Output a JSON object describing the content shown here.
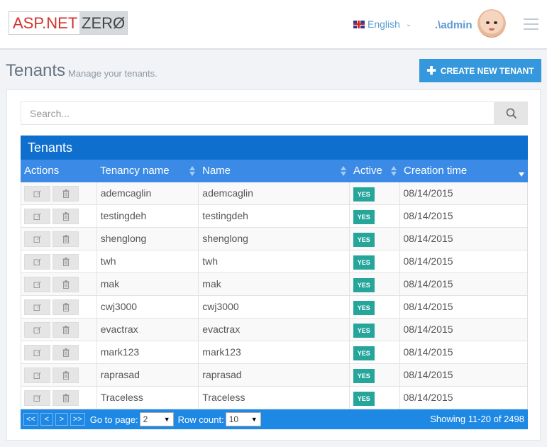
{
  "header": {
    "logo_left": "ASP.NET",
    "logo_right": "ZERØ",
    "language": "English",
    "username": ".\\admin",
    "language_icon": "uk-flag-icon",
    "menu_icon": "hamburger-icon"
  },
  "page": {
    "title": "Tenants",
    "subtitle": "Manage your tenants.",
    "create_button": "CREATE NEW TENANT"
  },
  "search": {
    "placeholder": "Search..."
  },
  "grid": {
    "title": "Tenants",
    "columns": [
      "Actions",
      "Tenancy name",
      "Name",
      "Active",
      "Creation time"
    ],
    "rows": [
      {
        "tenancy": "ademcaglin",
        "name": "ademcaglin",
        "active": "YES",
        "created": "08/14/2015"
      },
      {
        "tenancy": "testingdeh",
        "name": "testingdeh",
        "active": "YES",
        "created": "08/14/2015"
      },
      {
        "tenancy": "shenglong",
        "name": "shenglong",
        "active": "YES",
        "created": "08/14/2015"
      },
      {
        "tenancy": "twh",
        "name": "twh",
        "active": "YES",
        "created": "08/14/2015"
      },
      {
        "tenancy": "mak",
        "name": "mak",
        "active": "YES",
        "created": "08/14/2015"
      },
      {
        "tenancy": "cwj3000",
        "name": "cwj3000",
        "active": "YES",
        "created": "08/14/2015"
      },
      {
        "tenancy": "evactrax",
        "name": "evactrax",
        "active": "YES",
        "created": "08/14/2015"
      },
      {
        "tenancy": "mark123",
        "name": "mark123",
        "active": "YES",
        "created": "08/14/2015"
      },
      {
        "tenancy": "raprasad",
        "name": "raprasad",
        "active": "YES",
        "created": "08/14/2015"
      },
      {
        "tenancy": "Traceless",
        "name": "Traceless",
        "active": "YES",
        "created": "08/14/2015"
      }
    ],
    "footer": {
      "first": "<<",
      "prev": "<",
      "next": ">",
      "last": ">>",
      "goto_label": "Go to page:",
      "page_value": "2",
      "rowcount_label": "Row count:",
      "rowcount_value": "10",
      "showing": "Showing 11-20 of 2498"
    }
  },
  "colors": {
    "accent": "#3598dc",
    "grid_title": "#0f6fcf",
    "grid_header": "#3b8be6",
    "badge": "#26a69a"
  }
}
